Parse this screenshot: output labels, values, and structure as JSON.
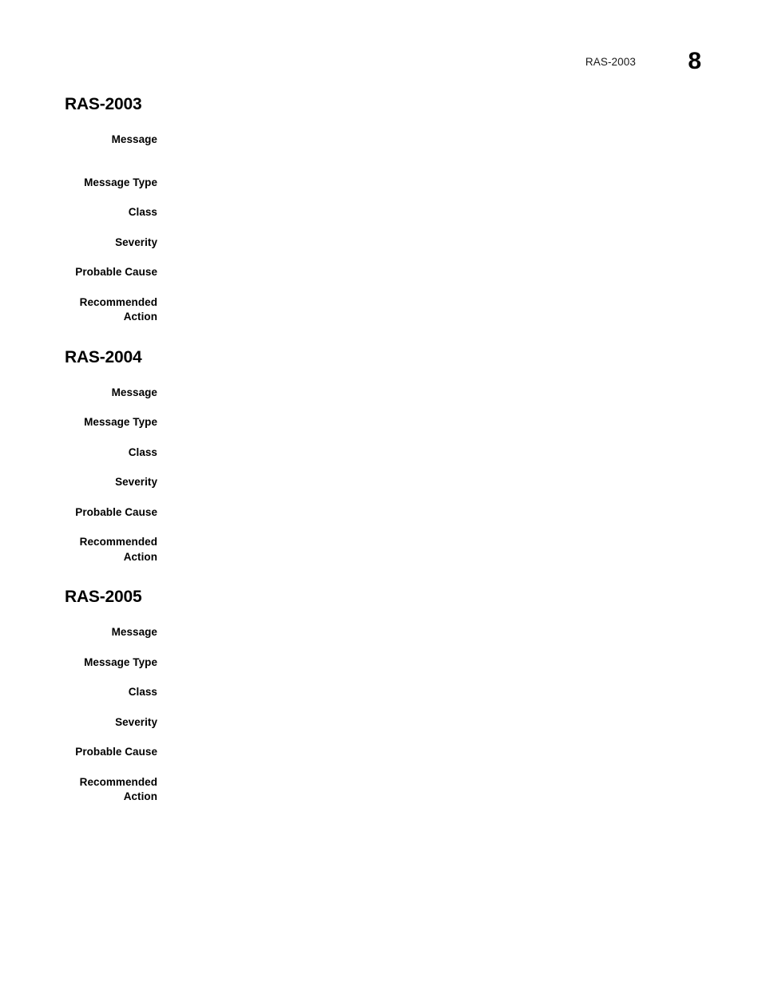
{
  "header": {
    "chapter": "RAS-2003",
    "page_number": "8"
  },
  "labels": {
    "message": "Message",
    "message_type": "Message Type",
    "class": "Class",
    "severity": "Severity",
    "probable_cause": "Probable Cause",
    "recommended_action": "Recommended\nAction"
  },
  "sections": [
    {
      "heading": "RAS-2003",
      "fields": [
        {
          "label": "Message",
          "value": ""
        },
        {
          "label": "Message Type",
          "value": ""
        },
        {
          "label": "Class",
          "value": ""
        },
        {
          "label": "Severity",
          "value": ""
        },
        {
          "label": "Probable Cause",
          "value": ""
        },
        {
          "label": "Recommended\nAction",
          "value": ""
        }
      ]
    },
    {
      "heading": "RAS-2004",
      "fields": [
        {
          "label": "Message",
          "value": ""
        },
        {
          "label": "Message Type",
          "value": ""
        },
        {
          "label": "Class",
          "value": ""
        },
        {
          "label": "Severity",
          "value": ""
        },
        {
          "label": "Probable Cause",
          "value": ""
        },
        {
          "label": "Recommended\nAction",
          "value": ""
        }
      ]
    },
    {
      "heading": "RAS-2005",
      "fields": [
        {
          "label": "Message",
          "value": ""
        },
        {
          "label": "Message Type",
          "value": ""
        },
        {
          "label": "Class",
          "value": ""
        },
        {
          "label": "Severity",
          "value": ""
        },
        {
          "label": "Probable Cause",
          "value": ""
        },
        {
          "label": "Recommended\nAction",
          "value": ""
        }
      ]
    }
  ]
}
